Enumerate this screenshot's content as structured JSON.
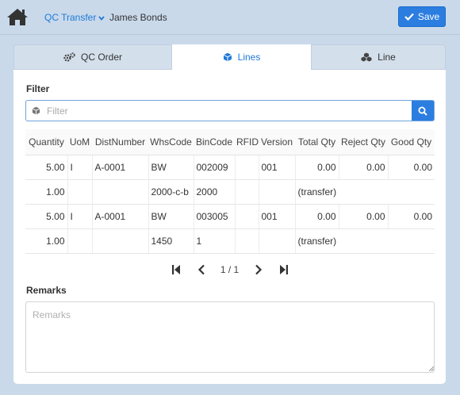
{
  "header": {
    "breadcrumb": "QC Transfer",
    "user": "James Bonds",
    "save_label": "Save"
  },
  "tabs": [
    {
      "label": "QC Order",
      "icon": "gears-icon",
      "active": false
    },
    {
      "label": "Lines",
      "icon": "cube-icon",
      "active": true
    },
    {
      "label": "Line",
      "icon": "cubes-icon",
      "active": false
    }
  ],
  "filter": {
    "label": "Filter",
    "placeholder": "Filter"
  },
  "table": {
    "columns": [
      "Quantity",
      "UoM",
      "DistNumber",
      "WhsCode",
      "BinCode",
      "RFID",
      "Version",
      "Total Qty",
      "Reject Qty",
      "Good Qty"
    ],
    "rows": [
      [
        "5.00",
        "I",
        "A-0001",
        "BW",
        "002009",
        "",
        "001",
        "0.00",
        "0.00",
        "0.00"
      ],
      [
        "1.00",
        "",
        "",
        "2000-c-b",
        "2000",
        "",
        "",
        "(transfer)",
        "",
        ""
      ],
      [
        "5.00",
        "I",
        "A-0001",
        "BW",
        "003005",
        "",
        "001",
        "0.00",
        "0.00",
        "0.00"
      ],
      [
        "1.00",
        "",
        "",
        "1450",
        "1",
        "",
        "",
        "(transfer)",
        "",
        ""
      ]
    ]
  },
  "pager": {
    "info": "1 / 1"
  },
  "remarks": {
    "label": "Remarks",
    "placeholder": "Remarks",
    "value": ""
  },
  "colors": {
    "accent": "#2b7de0",
    "background": "#c9d9ea",
    "tab_inactive": "#d3dfeb"
  }
}
